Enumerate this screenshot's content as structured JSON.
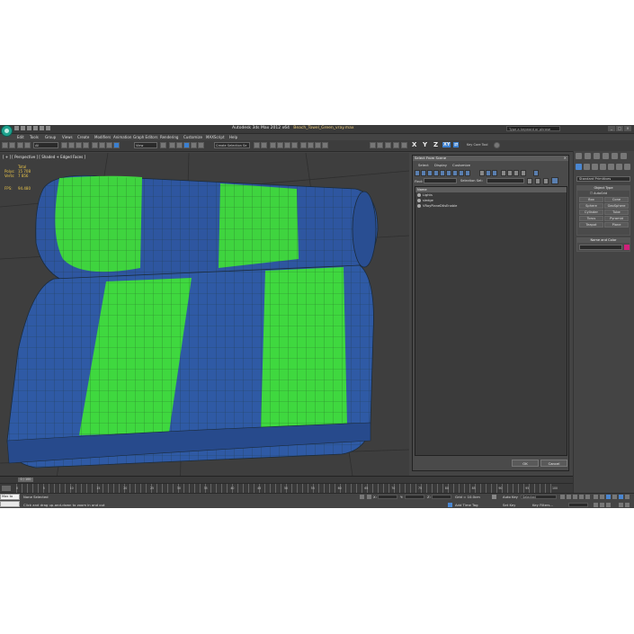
{
  "app": {
    "title": "Autodesk 3ds Max 2012 x64",
    "file": "Beach_Towel_Green_vray.max",
    "search_placeholder": "Type a keyword or phrase"
  },
  "menu": [
    "Edit",
    "Tools",
    "Group",
    "Views",
    "Create",
    "Modifiers",
    "Animation",
    "Graph Editors",
    "Rendering",
    "Customize",
    "MAXScript",
    "Help"
  ],
  "toolbar": {
    "filter_value": "All",
    "view_value": "View",
    "selection_set_value": "Create Selection Se",
    "axis": [
      "X",
      "Y",
      "Z",
      "XY"
    ],
    "active_axis": "XY",
    "isolate_label": "Key Core Tool"
  },
  "viewport": {
    "label": "[ + ] [ Perspective ] [ Shaded + Edged Faces ]",
    "stats": {
      "header": "Total",
      "polys_label": "Polys:",
      "polys_value": "15 708",
      "verts_label": "Verts:",
      "verts_value": "7 856",
      "fps_label": "FPS:",
      "fps_value": "94.480"
    },
    "colors": {
      "background": "#3e3e3e",
      "towel_blue": "#2f5aa5",
      "towel_green": "#3fd83f",
      "wire": "#1a2a1a"
    }
  },
  "dialog": {
    "title": "Select From Scene",
    "menu": [
      "Select",
      "Display",
      "Customize"
    ],
    "find_label": "Find:",
    "selection_set_label": "Selection Set:",
    "column_header": "Name",
    "items": [
      "Lights",
      "sledge",
      "VRayPlaneDtlsEnable"
    ],
    "ok_label": "OK",
    "cancel_label": "Cancel"
  },
  "command_panel": {
    "dropdown": "Standard Primitives",
    "object_type_title": "Object Type",
    "autogrid_label": "AutoGrid",
    "buttons": [
      "Box",
      "Cone",
      "Sphere",
      "GeoSphere",
      "Cylinder",
      "Tube",
      "Torus",
      "Pyramid",
      "Teapot",
      "Plane"
    ],
    "name_color_title": "Name and Color",
    "object_color": "#d0207a"
  },
  "timeline": {
    "slider_label": "0 / 100",
    "ticks": [
      "0",
      "5",
      "10",
      "15",
      "20",
      "25",
      "30",
      "35",
      "40",
      "45",
      "50",
      "55",
      "60",
      "65",
      "70",
      "75",
      "80",
      "85",
      "90",
      "95",
      "100"
    ]
  },
  "status": {
    "maxscript_label": "Max to",
    "selection_text": "None Selected",
    "prompt_text": "Click and drag up-and-down to zoom in and out",
    "x_label": "X:",
    "y_label": "Y:",
    "z_label": "Z:",
    "grid_text": "Grid = 10.0cm",
    "autokey_label": "Auto Key",
    "selected_value": "Selected",
    "setkey_label": "Set Key",
    "key_filters_label": "Key Filters...",
    "add_time_tag": "Add Time Tag"
  }
}
